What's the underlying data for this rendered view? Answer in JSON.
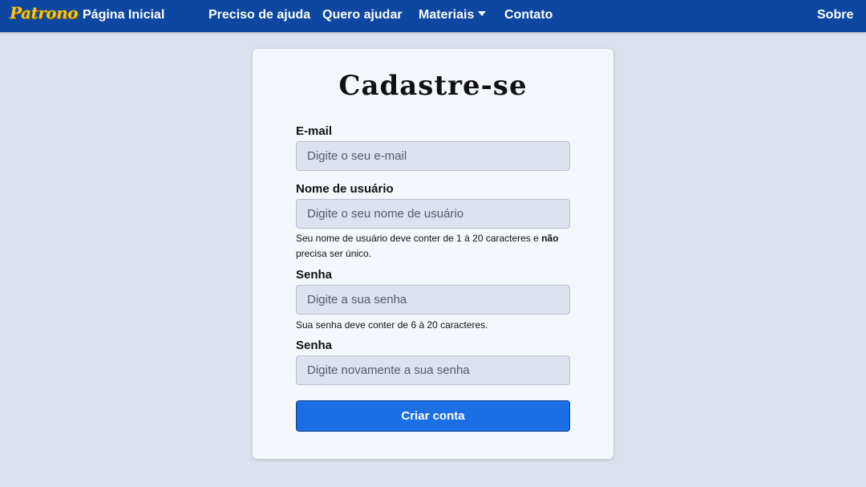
{
  "navbar": {
    "brand": "Patrono",
    "home": "Página Inicial",
    "need_help": "Preciso de ajuda",
    "want_help": "Quero ajudar",
    "materials": "Materiais",
    "contact": "Contato",
    "about": "Sobre"
  },
  "form": {
    "title": "Cadastre-se",
    "email_label": "E-mail",
    "email_placeholder": "Digite o seu e-mail",
    "username_label": "Nome de usuário",
    "username_placeholder": "Digite o seu nome de usuário",
    "username_help_prefix": "Seu nome de usuário deve conter de 1 à 20 caracteres e ",
    "username_help_bold": "não",
    "username_help_suffix": " precisa ser único.",
    "password_label": "Senha",
    "password_placeholder": "Digite a sua senha",
    "password_help": "Sua senha deve conter de 6 à 20 caracteres.",
    "password_confirm_label": "Senha",
    "password_confirm_placeholder": "Digite novamente a sua senha",
    "submit": "Criar conta"
  }
}
